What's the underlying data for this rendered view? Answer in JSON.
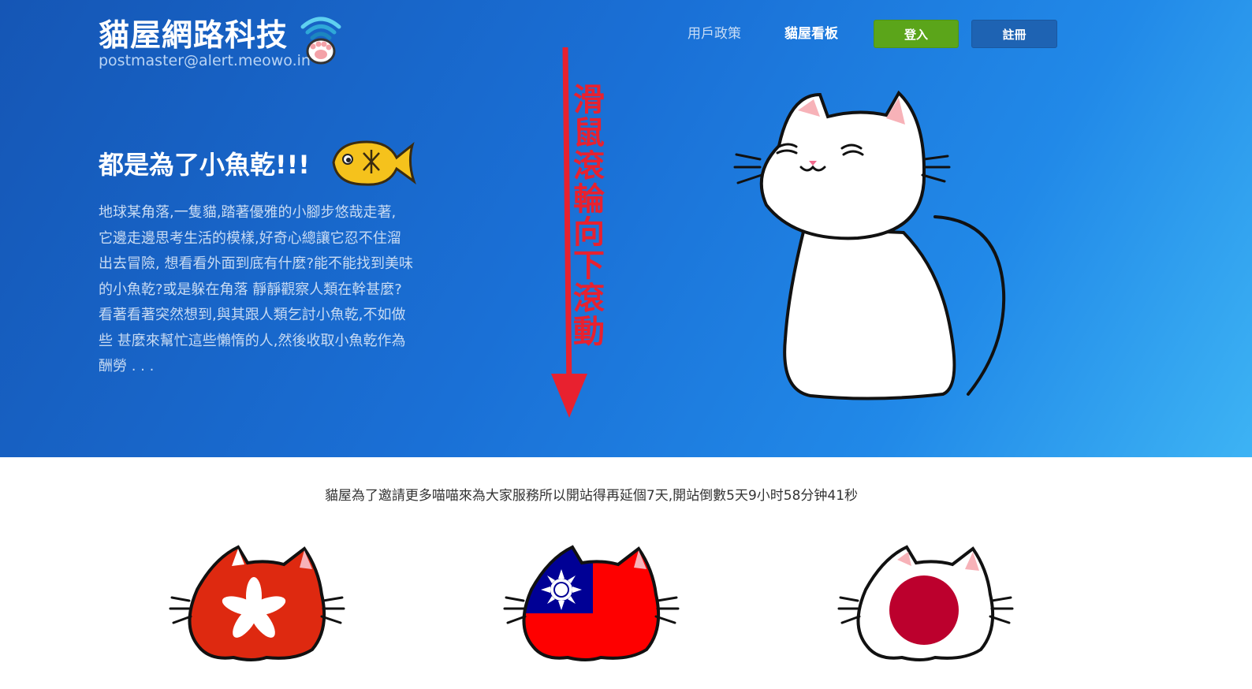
{
  "header": {
    "brand_title": "貓屋網路科技",
    "brand_email": "postmaster@alert.meowo.in",
    "brand_icon": "wifi-paw-icon",
    "nav": [
      {
        "label": "用戶政策",
        "active": false
      },
      {
        "label": "貓屋看板",
        "active": true
      }
    ],
    "login_label": "登入",
    "register_label": "註冊",
    "login_color": "#5ba51a",
    "register_color": "#1e63b3"
  },
  "hero": {
    "headline": "都是為了小魚乾!!!",
    "headline_icon": "dried-fish-icon",
    "intro": "地球某角落,一隻貓,踏著優雅的小腳步悠哉走著, 它邊走邊思考生活的模樣,好奇心總讓它忍不住溜出去冒險, 想看看外面到底有什麼?能不能找到美味的小魚乾?或是躲在角落 靜靜觀察人類在幹甚麼?看著看著突然想到,與其跟人類乞討小魚乾,不如做些 甚麼來幫忙這些懶惰的人,然後收取小魚乾作為酬勞 . . .",
    "scroll_hint": "滑鼠滾輪向下滾動",
    "scroll_color": "#e8212f",
    "gradient": [
      "#1556b5",
      "#3db3f4"
    ],
    "illustration": "white-cat-icon"
  },
  "notice": {
    "countdown": "貓屋為了邀請更多喵喵來為大家服務所以開站得再延個7天,開站倒數5天9小时58分钟41秒"
  },
  "flag_cats": [
    {
      "icon": "hong-kong-flag-cat-icon"
    },
    {
      "icon": "taiwan-flag-cat-icon"
    },
    {
      "icon": "japan-flag-cat-icon"
    }
  ]
}
